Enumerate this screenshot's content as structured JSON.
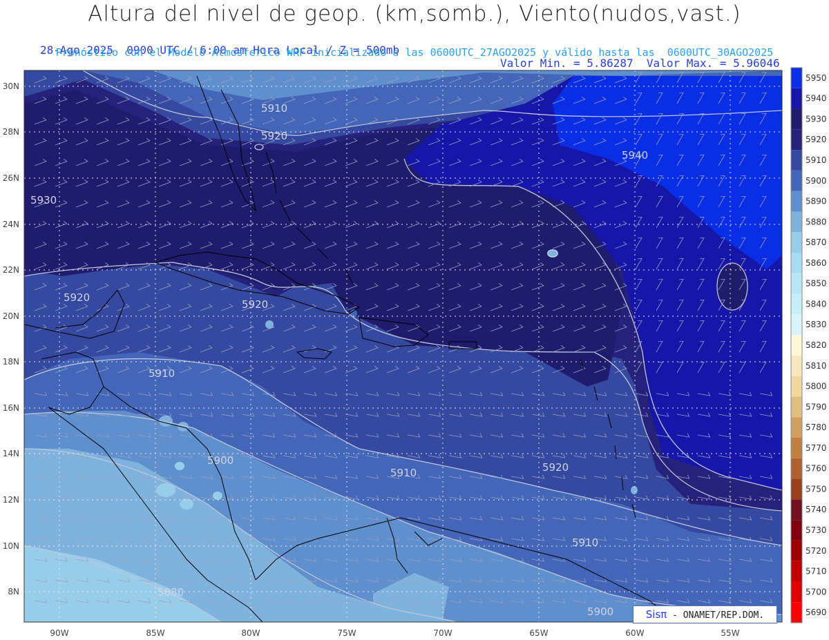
{
  "header": {
    "title": "Altura del nivel de geop. (km,somb.), Viento(nudos,vast.)",
    "subtitle_left": "28-Ago-2025  0900 UTC / 6:00 am Hora Local / Z = 500mb",
    "subtitle_right": "Valor Min. = 5.86287  Valor Max. = 5.96046",
    "line3": "Pronóstico con el Modelo Atmosferico WRF inicializado a las 0600UTC_27AGO2025 y válido hasta las  0600UTC_30AGO2025"
  },
  "axes": {
    "lat_labels": [
      "30N",
      "28N",
      "26N",
      "24N",
      "22N",
      "20N",
      "18N",
      "16N",
      "14N",
      "12N",
      "10N",
      "8N"
    ],
    "lon_labels": [
      "90W",
      "85W",
      "80W",
      "75W",
      "70W",
      "65W",
      "60W",
      "55W"
    ]
  },
  "colorbar": {
    "levels": [
      "5690",
      "5700",
      "5710",
      "5720",
      "5730",
      "5740",
      "5750",
      "5760",
      "5770",
      "5780",
      "5790",
      "5800",
      "5810",
      "5820",
      "5830",
      "5840",
      "5850",
      "5860",
      "5870",
      "5880",
      "5890",
      "5900",
      "5910",
      "5920",
      "5930",
      "5940",
      "5950"
    ],
    "colors": [
      "#ff0000",
      "#e00000",
      "#c00000",
      "#a00000",
      "#800010",
      "#701020",
      "#9a4020",
      "#b06030",
      "#c08040",
      "#d0a060",
      "#e0c080",
      "#f0d8a0",
      "#f8e8c0",
      "#fff8d8",
      "#d8f4fa",
      "#c8eef8",
      "#b8e6f6",
      "#a8dcf2",
      "#98cde9",
      "#7fb3de",
      "#5f8fcc",
      "#4466b8",
      "#34499f",
      "#26217a",
      "#1f1c6e",
      "#1616a8",
      "#0a2de6"
    ]
  },
  "contour_labels": [
    "5910",
    "5920",
    "5940",
    "5930",
    "5920",
    "5920",
    "5910",
    "5900",
    "5910",
    "5920",
    "5910",
    "5900",
    "5880"
  ],
  "colors": {
    "title": "#222222",
    "subtitle": "#2a40e0",
    "line3": "#2aa0f0"
  },
  "credit": {
    "brand": "Sisπ",
    "text": "- ONAMET/REP.DOM."
  }
}
